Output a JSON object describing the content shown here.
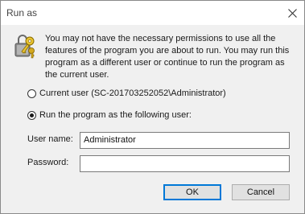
{
  "window": {
    "title": "Run as"
  },
  "message": "You may not have the necessary permissions to use all the features of the program you are about to run. You may run this program as a different user or continue to run the program as the current user.",
  "options": {
    "current_user": {
      "label": "Current user (SC-201703252052\\Administrator)",
      "checked": false
    },
    "following_user": {
      "label": "Run the program as the following user:",
      "checked": true
    }
  },
  "fields": {
    "username": {
      "label": "User name:",
      "value": "Administrator"
    },
    "password": {
      "label": "Password:",
      "value": ""
    }
  },
  "buttons": {
    "ok": "OK",
    "cancel": "Cancel"
  },
  "icons": {
    "info": "keys-icon",
    "close": "close-icon"
  }
}
